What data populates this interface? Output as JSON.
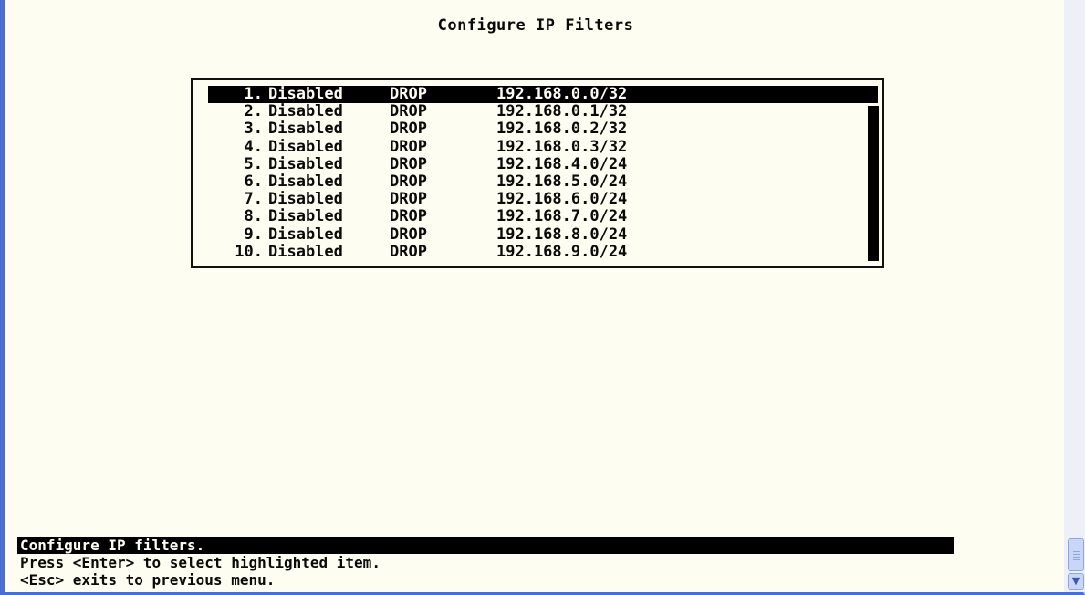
{
  "screen": {
    "title": "Configure IP Filters"
  },
  "filters": [
    {
      "num": "1.",
      "state": "Disabled",
      "action": "DROP",
      "network": "192.168.0.0/32"
    },
    {
      "num": "2.",
      "state": "Disabled",
      "action": "DROP",
      "network": "192.168.0.1/32"
    },
    {
      "num": "3.",
      "state": "Disabled",
      "action": "DROP",
      "network": "192.168.0.2/32"
    },
    {
      "num": "4.",
      "state": "Disabled",
      "action": "DROP",
      "network": "192.168.0.3/32"
    },
    {
      "num": "5.",
      "state": "Disabled",
      "action": "DROP",
      "network": "192.168.4.0/24"
    },
    {
      "num": "6.",
      "state": "Disabled",
      "action": "DROP",
      "network": "192.168.5.0/24"
    },
    {
      "num": "7.",
      "state": "Disabled",
      "action": "DROP",
      "network": "192.168.6.0/24"
    },
    {
      "num": "8.",
      "state": "Disabled",
      "action": "DROP",
      "network": "192.168.7.0/24"
    },
    {
      "num": "9.",
      "state": "Disabled",
      "action": "DROP",
      "network": "192.168.8.0/24"
    },
    {
      "num": "10.",
      "state": "Disabled",
      "action": "DROP",
      "network": "192.168.9.0/24"
    }
  ],
  "selected_index": 0,
  "status": {
    "line1": "Configure IP filters.",
    "line2": "Press <Enter> to select highlighted item.",
    "line3": "<Esc> exits to previous menu."
  },
  "colors": {
    "background": "#fefdf2",
    "foreground": "#0a0a0a",
    "highlight_bg": "#000000",
    "window_frame": "#4a6ed8"
  },
  "icons": {
    "scroll_down": "chevron-down-icon"
  }
}
